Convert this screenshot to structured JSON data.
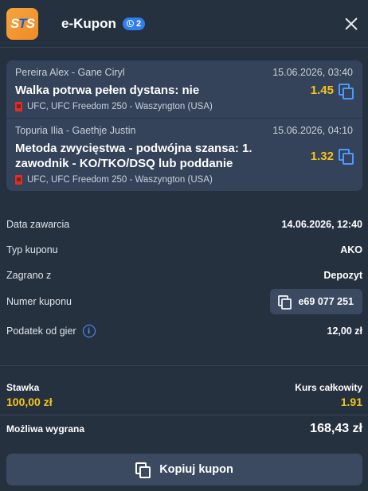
{
  "header": {
    "logo_text_1": "S",
    "logo_text_2": "T",
    "logo_text_3": "S",
    "title": "e-Kupon",
    "badge_count": "2",
    "close_icon": "close-icon"
  },
  "bets": [
    {
      "participants": "Pereira Alex - Gane Ciryl",
      "datetime": "15.06.2026, 03:40",
      "pick": "Walka potrwa pełen dystans: nie",
      "odd": "1.45",
      "event": "UFC, UFC Freedom 250 - Waszyngton (USA)"
    },
    {
      "participants": "Topuria Ilia - Gaethje Justin",
      "datetime": "15.06.2026, 04:10",
      "pick": "Metoda zwycięstwa - podwójna szansa: 1. zawodnik - KO/TKO/DSQ lub poddanie",
      "odd": "1.32",
      "event": "UFC, UFC Freedom 250 - Waszyngton (USA)"
    }
  ],
  "details": {
    "date_label": "Data zawarcia",
    "date_value": "14.06.2026, 12:40",
    "type_label": "Typ kuponu",
    "type_value": "AKO",
    "played_label": "Zagrano z",
    "played_value": "Depozyt",
    "number_label": "Numer kuponu",
    "number_value": "e69 077 251",
    "tax_label": "Podatek od gier",
    "tax_value": "12,00 zł"
  },
  "summary": {
    "stake_label": "Stawka",
    "stake_value": "100,00 zł",
    "total_odds_label": "Kurs całkowity",
    "total_odds_value": "1.91",
    "possible_win_label": "Możliwa wygrana",
    "possible_win_value": "168,43 zł"
  },
  "footer": {
    "copy_button_label": "Kopiuj kupon"
  },
  "colors": {
    "background": "#263140",
    "card": "#34425a",
    "accent_yellow": "#f5c518",
    "accent_blue": "#4c9aff",
    "logo_orange": "#f08a2a"
  }
}
